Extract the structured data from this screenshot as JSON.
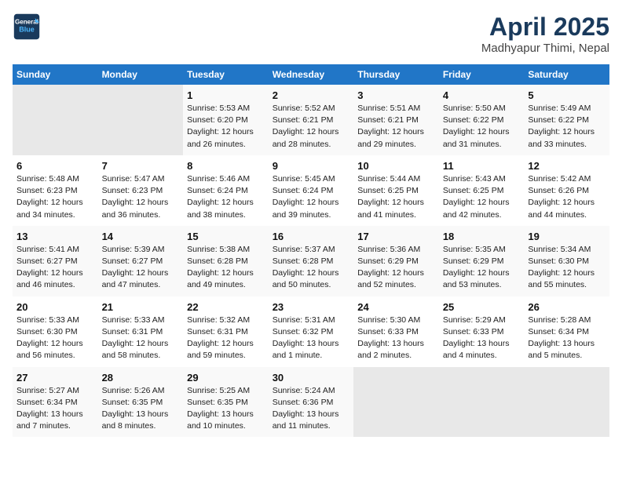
{
  "logo": {
    "line1": "General",
    "line2": "Blue"
  },
  "title": "April 2025",
  "subtitle": "Madhyapur Thimi, Nepal",
  "days_of_week": [
    "Sunday",
    "Monday",
    "Tuesday",
    "Wednesday",
    "Thursday",
    "Friday",
    "Saturday"
  ],
  "weeks": [
    [
      {
        "day": "",
        "sunrise": "",
        "sunset": "",
        "daylight": ""
      },
      {
        "day": "",
        "sunrise": "",
        "sunset": "",
        "daylight": ""
      },
      {
        "day": "1",
        "sunrise": "Sunrise: 5:53 AM",
        "sunset": "Sunset: 6:20 PM",
        "daylight": "Daylight: 12 hours and 26 minutes."
      },
      {
        "day": "2",
        "sunrise": "Sunrise: 5:52 AM",
        "sunset": "Sunset: 6:21 PM",
        "daylight": "Daylight: 12 hours and 28 minutes."
      },
      {
        "day": "3",
        "sunrise": "Sunrise: 5:51 AM",
        "sunset": "Sunset: 6:21 PM",
        "daylight": "Daylight: 12 hours and 29 minutes."
      },
      {
        "day": "4",
        "sunrise": "Sunrise: 5:50 AM",
        "sunset": "Sunset: 6:22 PM",
        "daylight": "Daylight: 12 hours and 31 minutes."
      },
      {
        "day": "5",
        "sunrise": "Sunrise: 5:49 AM",
        "sunset": "Sunset: 6:22 PM",
        "daylight": "Daylight: 12 hours and 33 minutes."
      }
    ],
    [
      {
        "day": "6",
        "sunrise": "Sunrise: 5:48 AM",
        "sunset": "Sunset: 6:23 PM",
        "daylight": "Daylight: 12 hours and 34 minutes."
      },
      {
        "day": "7",
        "sunrise": "Sunrise: 5:47 AM",
        "sunset": "Sunset: 6:23 PM",
        "daylight": "Daylight: 12 hours and 36 minutes."
      },
      {
        "day": "8",
        "sunrise": "Sunrise: 5:46 AM",
        "sunset": "Sunset: 6:24 PM",
        "daylight": "Daylight: 12 hours and 38 minutes."
      },
      {
        "day": "9",
        "sunrise": "Sunrise: 5:45 AM",
        "sunset": "Sunset: 6:24 PM",
        "daylight": "Daylight: 12 hours and 39 minutes."
      },
      {
        "day": "10",
        "sunrise": "Sunrise: 5:44 AM",
        "sunset": "Sunset: 6:25 PM",
        "daylight": "Daylight: 12 hours and 41 minutes."
      },
      {
        "day": "11",
        "sunrise": "Sunrise: 5:43 AM",
        "sunset": "Sunset: 6:25 PM",
        "daylight": "Daylight: 12 hours and 42 minutes."
      },
      {
        "day": "12",
        "sunrise": "Sunrise: 5:42 AM",
        "sunset": "Sunset: 6:26 PM",
        "daylight": "Daylight: 12 hours and 44 minutes."
      }
    ],
    [
      {
        "day": "13",
        "sunrise": "Sunrise: 5:41 AM",
        "sunset": "Sunset: 6:27 PM",
        "daylight": "Daylight: 12 hours and 46 minutes."
      },
      {
        "day": "14",
        "sunrise": "Sunrise: 5:39 AM",
        "sunset": "Sunset: 6:27 PM",
        "daylight": "Daylight: 12 hours and 47 minutes."
      },
      {
        "day": "15",
        "sunrise": "Sunrise: 5:38 AM",
        "sunset": "Sunset: 6:28 PM",
        "daylight": "Daylight: 12 hours and 49 minutes."
      },
      {
        "day": "16",
        "sunrise": "Sunrise: 5:37 AM",
        "sunset": "Sunset: 6:28 PM",
        "daylight": "Daylight: 12 hours and 50 minutes."
      },
      {
        "day": "17",
        "sunrise": "Sunrise: 5:36 AM",
        "sunset": "Sunset: 6:29 PM",
        "daylight": "Daylight: 12 hours and 52 minutes."
      },
      {
        "day": "18",
        "sunrise": "Sunrise: 5:35 AM",
        "sunset": "Sunset: 6:29 PM",
        "daylight": "Daylight: 12 hours and 53 minutes."
      },
      {
        "day": "19",
        "sunrise": "Sunrise: 5:34 AM",
        "sunset": "Sunset: 6:30 PM",
        "daylight": "Daylight: 12 hours and 55 minutes."
      }
    ],
    [
      {
        "day": "20",
        "sunrise": "Sunrise: 5:33 AM",
        "sunset": "Sunset: 6:30 PM",
        "daylight": "Daylight: 12 hours and 56 minutes."
      },
      {
        "day": "21",
        "sunrise": "Sunrise: 5:33 AM",
        "sunset": "Sunset: 6:31 PM",
        "daylight": "Daylight: 12 hours and 58 minutes."
      },
      {
        "day": "22",
        "sunrise": "Sunrise: 5:32 AM",
        "sunset": "Sunset: 6:31 PM",
        "daylight": "Daylight: 12 hours and 59 minutes."
      },
      {
        "day": "23",
        "sunrise": "Sunrise: 5:31 AM",
        "sunset": "Sunset: 6:32 PM",
        "daylight": "Daylight: 13 hours and 1 minute."
      },
      {
        "day": "24",
        "sunrise": "Sunrise: 5:30 AM",
        "sunset": "Sunset: 6:33 PM",
        "daylight": "Daylight: 13 hours and 2 minutes."
      },
      {
        "day": "25",
        "sunrise": "Sunrise: 5:29 AM",
        "sunset": "Sunset: 6:33 PM",
        "daylight": "Daylight: 13 hours and 4 minutes."
      },
      {
        "day": "26",
        "sunrise": "Sunrise: 5:28 AM",
        "sunset": "Sunset: 6:34 PM",
        "daylight": "Daylight: 13 hours and 5 minutes."
      }
    ],
    [
      {
        "day": "27",
        "sunrise": "Sunrise: 5:27 AM",
        "sunset": "Sunset: 6:34 PM",
        "daylight": "Daylight: 13 hours and 7 minutes."
      },
      {
        "day": "28",
        "sunrise": "Sunrise: 5:26 AM",
        "sunset": "Sunset: 6:35 PM",
        "daylight": "Daylight: 13 hours and 8 minutes."
      },
      {
        "day": "29",
        "sunrise": "Sunrise: 5:25 AM",
        "sunset": "Sunset: 6:35 PM",
        "daylight": "Daylight: 13 hours and 10 minutes."
      },
      {
        "day": "30",
        "sunrise": "Sunrise: 5:24 AM",
        "sunset": "Sunset: 6:36 PM",
        "daylight": "Daylight: 13 hours and 11 minutes."
      },
      {
        "day": "",
        "sunrise": "",
        "sunset": "",
        "daylight": ""
      },
      {
        "day": "",
        "sunrise": "",
        "sunset": "",
        "daylight": ""
      },
      {
        "day": "",
        "sunrise": "",
        "sunset": "",
        "daylight": ""
      }
    ]
  ]
}
